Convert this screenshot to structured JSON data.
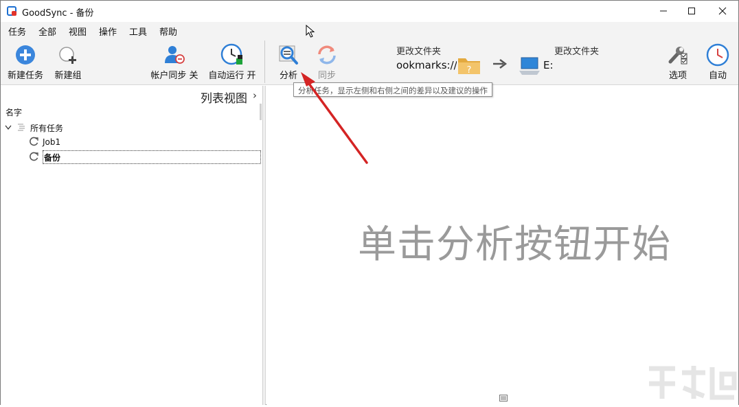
{
  "window": {
    "title": "GoodSync - 备份"
  },
  "menu": [
    "任务",
    "全部",
    "视图",
    "操作",
    "工具",
    "帮助"
  ],
  "toolbar": {
    "new_job": "新建任务",
    "new_group": "新建组",
    "account_sync": "帐户同步 关",
    "auto_run": "自动运行 开",
    "analyze": "分析",
    "sync": "同步",
    "left_change": "更改文件夹",
    "left_path": "ookmarks://",
    "right_change": "更改文件夹",
    "right_path": "E:",
    "options": "选项",
    "auto": "自动"
  },
  "tooltip": "分析任务，显示左侧和右侧之间的差异以及建议的操作",
  "left_pane": {
    "list_view": "列表视图",
    "list_view_chevron": "›",
    "column_header": "名字",
    "tree": {
      "group": "所有任务",
      "jobs": [
        {
          "name": "Job1",
          "selected": false
        },
        {
          "name": "备份",
          "selected": true
        }
      ]
    }
  },
  "right_pane": {
    "hint": "单击分析按钮开始"
  },
  "colors": {
    "accent_blue": "#2f7fd6",
    "arrow_red": "#d42424",
    "toolbar_bg": "#f3f3f3",
    "hint_gray": "#9a9a9a"
  },
  "icons": [
    "plus-circle-icon",
    "new-group-icon",
    "account-sync-icon",
    "auto-run-clock-icon",
    "analyze-magnifier-icon",
    "sync-arrows-icon",
    "folder-question-icon",
    "right-arrow-icon",
    "computer-icon",
    "options-wrench-icon",
    "auto-clock-icon",
    "refresh-icon",
    "list-icon"
  ]
}
